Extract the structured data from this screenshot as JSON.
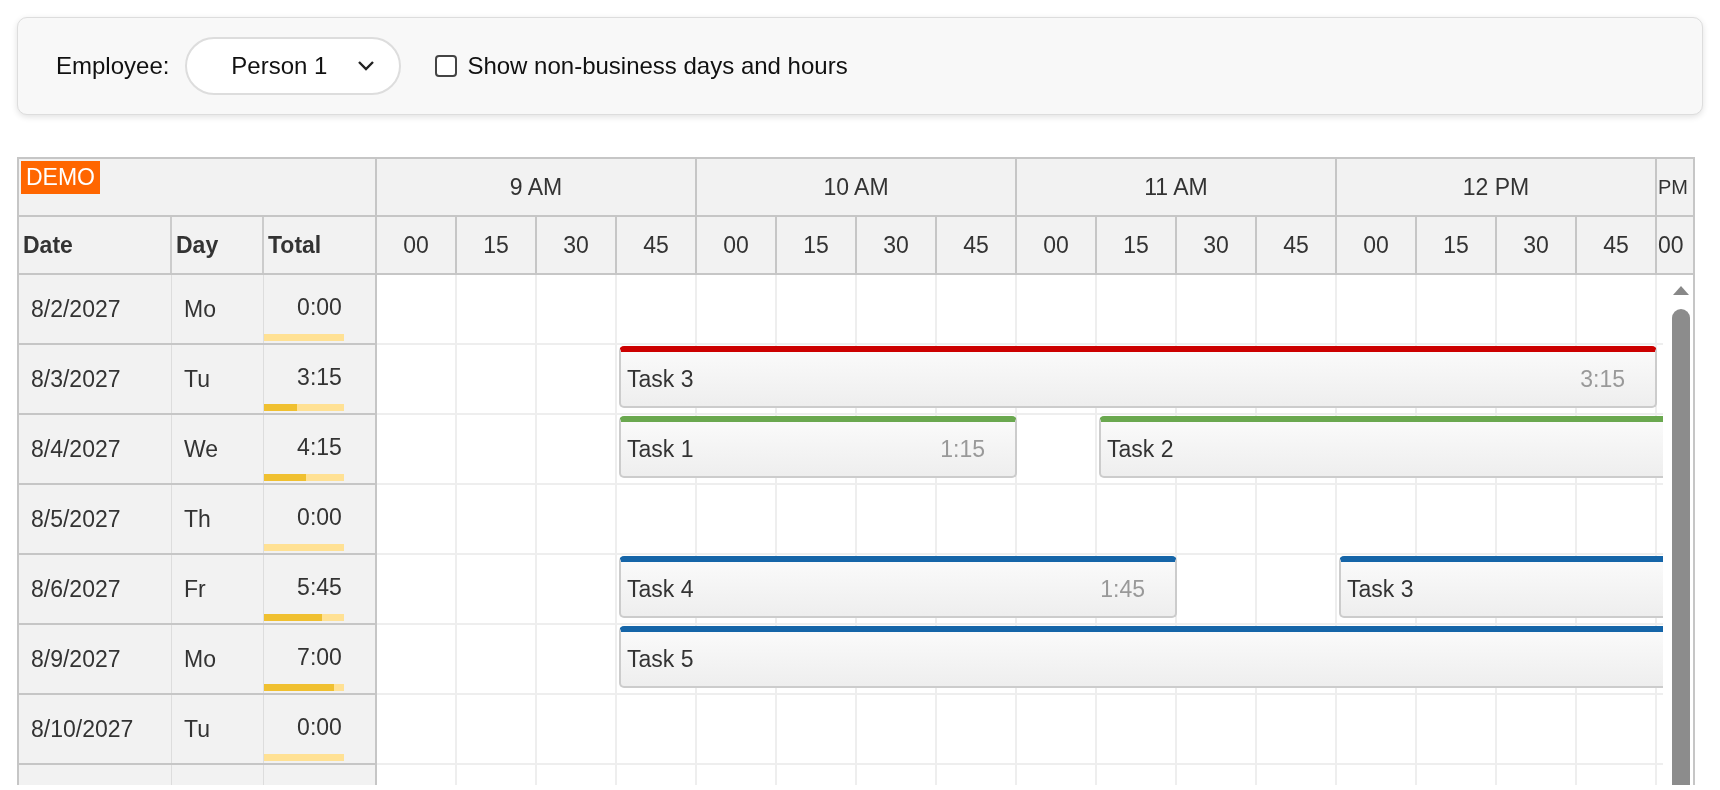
{
  "toolbar": {
    "employee_label": "Employee:",
    "employee_select": {
      "value": "Person 1"
    },
    "show_nonbusiness": {
      "label": "Show non-business days and hours",
      "checked": false
    }
  },
  "scheduler": {
    "demo_badge": "DEMO",
    "columns": [
      "Date",
      "Day",
      "Total"
    ],
    "hours": [
      "9 AM",
      "10 AM",
      "11 AM",
      "12 PM",
      "PM"
    ],
    "minutes": [
      "00",
      "15",
      "30",
      "45",
      "00",
      "15",
      "30",
      "45",
      "00",
      "15",
      "30",
      "45",
      "00",
      "15",
      "30",
      "45",
      "00"
    ],
    "rows": [
      {
        "date": "8/2/2027",
        "day": "Mo",
        "total": "0:00",
        "level": 0
      },
      {
        "date": "8/3/2027",
        "day": "Tu",
        "total": "3:15",
        "level": 0.41,
        "timeline": [
          {
            "kind": "gap"
          },
          {
            "kind": "gap"
          },
          {
            "kind": "gap"
          },
          {
            "kind": "task",
            "text": "Task 3",
            "duration": "3:15",
            "color": "#cc0000"
          }
        ]
      },
      {
        "date": "8/4/2027",
        "day": "We",
        "total": "4:15",
        "level": 0.53,
        "timeline": [
          {
            "kind": "gap"
          },
          {
            "kind": "gap"
          },
          {
            "kind": "gap"
          },
          {
            "kind": "task",
            "text": "Task 1",
            "duration": "1:15",
            "color": "#6aa84f"
          },
          {
            "kind": "gap"
          },
          {
            "kind": "task",
            "text": "Task 2",
            "color": "#6aa84f"
          }
        ]
      },
      {
        "date": "8/5/2027",
        "day": "Th",
        "total": "0:00",
        "level": 0
      },
      {
        "date": "8/6/2027",
        "day": "Fr",
        "total": "5:45",
        "level": 0.72,
        "timeline": [
          {
            "kind": "gap"
          },
          {
            "kind": "gap"
          },
          {
            "kind": "gap"
          },
          {
            "kind": "task",
            "text": "Task 4",
            "duration": "1:45",
            "color": "#1565a8"
          },
          {
            "kind": "gap"
          },
          {
            "kind": "gap"
          },
          {
            "kind": "task",
            "text": "Task 3",
            "color": "#1565a8"
          }
        ]
      },
      {
        "date": "8/9/2027",
        "day": "Mo",
        "total": "7:00",
        "level": 0.87,
        "timeline": [
          {
            "kind": "gap"
          },
          {
            "kind": "gap"
          },
          {
            "kind": "gap"
          },
          {
            "kind": "task",
            "text": "Task 5",
            "color": "#1565a8"
          }
        ]
      },
      {
        "date": "8/10/2027",
        "day": "Tu",
        "total": "0:00",
        "level": 0
      }
    ]
  }
}
